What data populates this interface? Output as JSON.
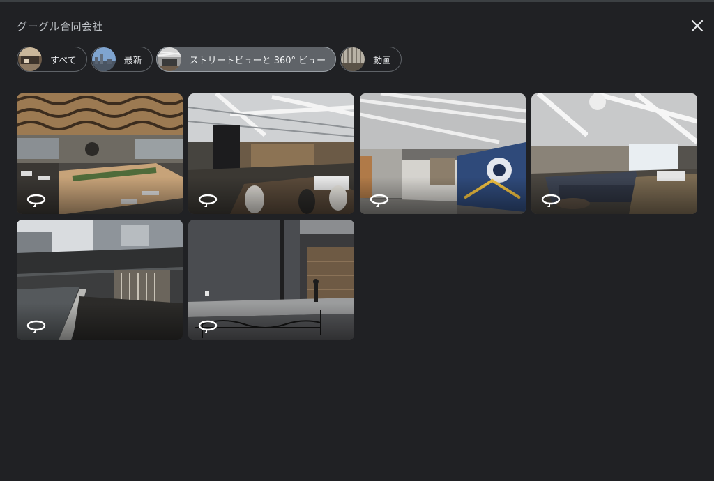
{
  "header": {
    "title": "グーグル合同会社",
    "close_icon": "close-icon"
  },
  "filters": [
    {
      "label": "すべて",
      "active": false
    },
    {
      "label": "最新",
      "active": false
    },
    {
      "label": "ストリートビューと 360° ビュー",
      "active": true
    },
    {
      "label": "動画",
      "active": false
    }
  ],
  "colors": {
    "background": "#202124",
    "chip_active": "#5f6368",
    "chip_border": "#5f6368",
    "text": "#e8eaed"
  },
  "gallery": {
    "badge_icon": "360-rotate-icon",
    "tiles": [
      {
        "scene": "office-cafeteria-lattice-ceiling"
      },
      {
        "scene": "office-hall-exposed-ducts"
      },
      {
        "scene": "office-corridor-mural"
      },
      {
        "scene": "office-lounge-sofas"
      },
      {
        "scene": "street-overpass"
      },
      {
        "scene": "street-building-entrance"
      }
    ]
  }
}
